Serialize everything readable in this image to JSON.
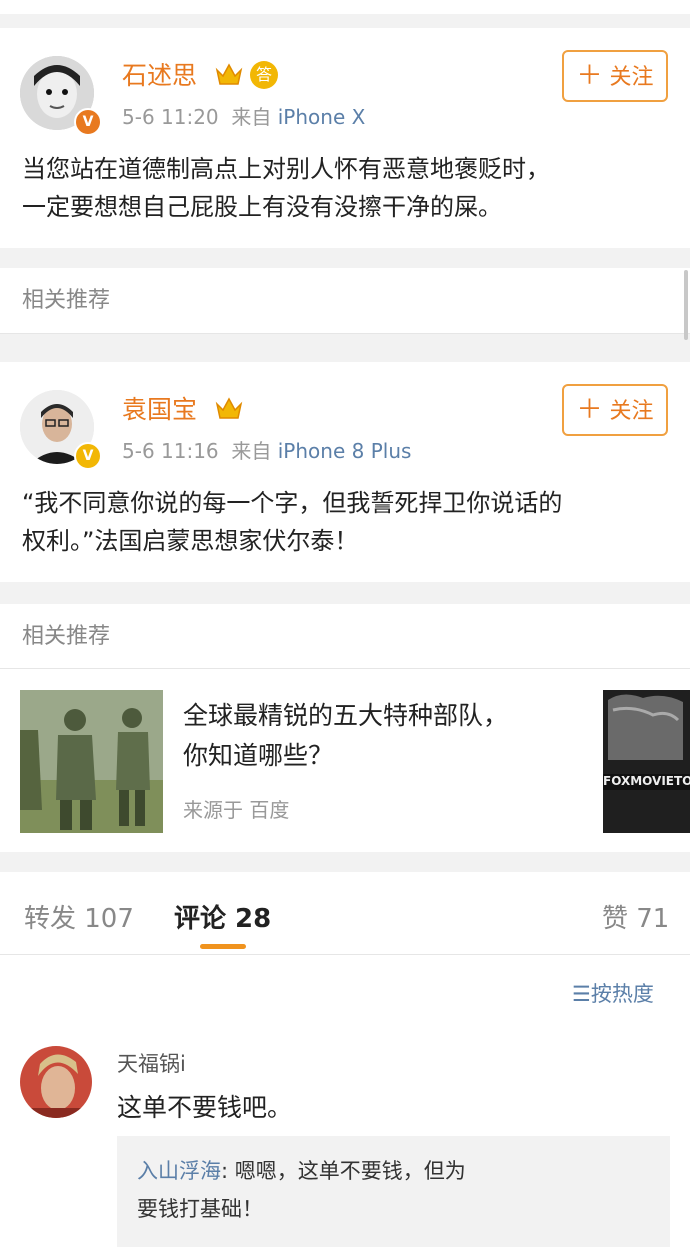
{
  "posts": [
    {
      "username": "石述思",
      "time": "5-6 11:20",
      "from_label": "来自",
      "device": "iPhone X",
      "badge_answer": "答",
      "follow_label": "关注",
      "text_line1": "当您站在道德制高点上对别人怀有恶意地褒贬时，",
      "text_line2": "一定要想想自己屁股上有没有没擦干净的屎。",
      "verified_color": "#e8791f"
    },
    {
      "username": "袁国宝",
      "time": "5-6 11:16",
      "from_label": "来自",
      "device": "iPhone 8 Plus",
      "follow_label": "关注",
      "text_line1": "“我不同意你说的每一个字，但我誓死捍卫你说话的",
      "text_line2": "权利。”法国启蒙思想家伏尔泰！",
      "verified_color": "#f2b705"
    }
  ],
  "recommend_label": "相关推荐",
  "recommend_item": {
    "title_line1": "全球最精锐的五大特种部队，",
    "title_line2": "你知道哪些？",
    "source": "来源于 百度",
    "side_image_text": "FOXMOVIETONE"
  },
  "tabs": {
    "repost": "转发 107",
    "comment": "评论 28",
    "like": "赞 71",
    "active": "comment"
  },
  "sort_label": "按热度",
  "comment": {
    "username": "天福锅i",
    "text": "这单不要钱吧。",
    "reply_user": "入山浮海",
    "reply_text_line1": ": 嗯嗯，这单不要钱，但为",
    "reply_text_line2": "要钱打基础！"
  },
  "colors": {
    "accent": "#e8791f",
    "link": "#5b7fa8",
    "tab_indicator": "#f0931e"
  }
}
